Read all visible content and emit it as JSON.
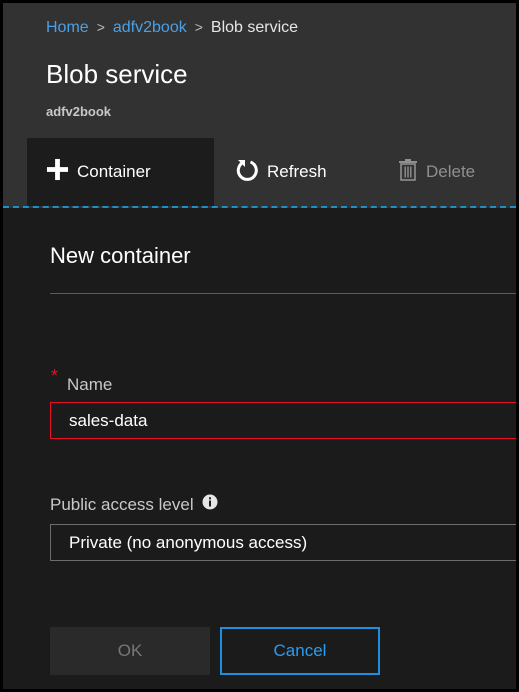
{
  "breadcrumb": {
    "home": "Home",
    "sep1": ">",
    "account": "adfv2book",
    "sep2": ">",
    "current": "Blob service"
  },
  "blade": {
    "title": "Blob service",
    "subtitle": "adfv2book"
  },
  "toolbar": {
    "container_label": "Container",
    "container_icon": "plus-icon",
    "refresh_label": "Refresh",
    "refresh_icon": "refresh-icon",
    "delete_label": "Delete",
    "delete_icon": "trash-icon"
  },
  "panel": {
    "title": "New container",
    "name_field": {
      "required_marker": "*",
      "label": "Name",
      "value": "sales-data"
    },
    "access_field": {
      "label": "Public access level",
      "info_icon": "info-icon",
      "selected": "Private (no anonymous access)"
    },
    "ok_label": "OK",
    "cancel_label": "Cancel"
  },
  "colors": {
    "accent": "#1e8fdf",
    "link": "#4aa0e6",
    "error": "#e81123",
    "background": "#1b1b1b",
    "header": "#323232"
  }
}
